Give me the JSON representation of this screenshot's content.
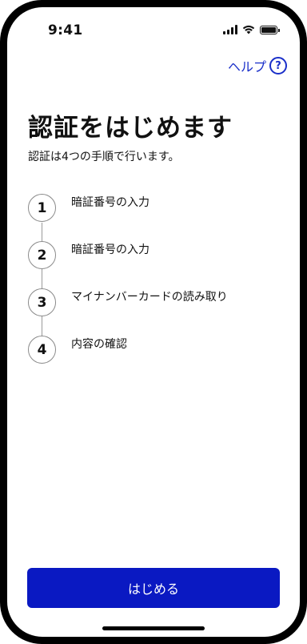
{
  "status_bar": {
    "time": "9:41",
    "icons": [
      "cellular-signal-icon",
      "wifi-icon",
      "battery-icon"
    ]
  },
  "header": {
    "help_label": "ヘルプ",
    "help_icon_glyph": "?"
  },
  "main": {
    "title": "認証をはじめます",
    "subtitle": "認証は4つの手順で行います。",
    "steps": [
      {
        "number": "1",
        "label": "暗証番号の入力"
      },
      {
        "number": "2",
        "label": "暗証番号の入力"
      },
      {
        "number": "3",
        "label": "マイナンバーカードの読み取り"
      },
      {
        "number": "4",
        "label": "内容の確認"
      }
    ]
  },
  "footer": {
    "start_button_label": "はじめる"
  },
  "colors": {
    "accent": "#0a19c2",
    "link": "#1a2fc9",
    "text": "#111111",
    "step_border": "#8a8a8a"
  }
}
